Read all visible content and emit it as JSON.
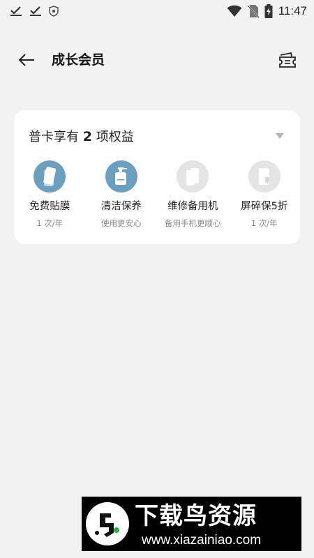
{
  "status_bar": {
    "time": "11:47",
    "left_icons": [
      "check-download-icon",
      "check-download-icon",
      "shield-icon"
    ],
    "right_icons": [
      "wifi-icon",
      "no-sim-icon",
      "battery-charging-icon"
    ]
  },
  "header": {
    "title": "成长会员",
    "back_icon": "arrow-left-icon",
    "action_icon": "ticket-icon"
  },
  "card": {
    "title_prefix": "普卡享有",
    "title_count": "2",
    "title_suffix": "项权益",
    "benefits": [
      {
        "name": "免费贴膜",
        "desc": "1 次/年",
        "active": true,
        "icon": "screen-film-icon"
      },
      {
        "name": "清洁保养",
        "desc": "使用更安心",
        "active": true,
        "icon": "cleaning-bottle-icon"
      },
      {
        "name": "维修备用机",
        "desc": "备用手机更顺心",
        "active": false,
        "icon": "backup-phone-icon"
      },
      {
        "name": "屏碎保5折",
        "desc": "1 次/年",
        "active": false,
        "icon": "screen-protect-icon"
      }
    ]
  },
  "watermark": {
    "title": "下载鸟资源",
    "url": "www.xiazainiao.com"
  },
  "colors": {
    "background": "#f2f2f2",
    "card": "#ffffff",
    "active_icon": "#6a9fc0",
    "inactive_icon": "#e4e4e4"
  }
}
